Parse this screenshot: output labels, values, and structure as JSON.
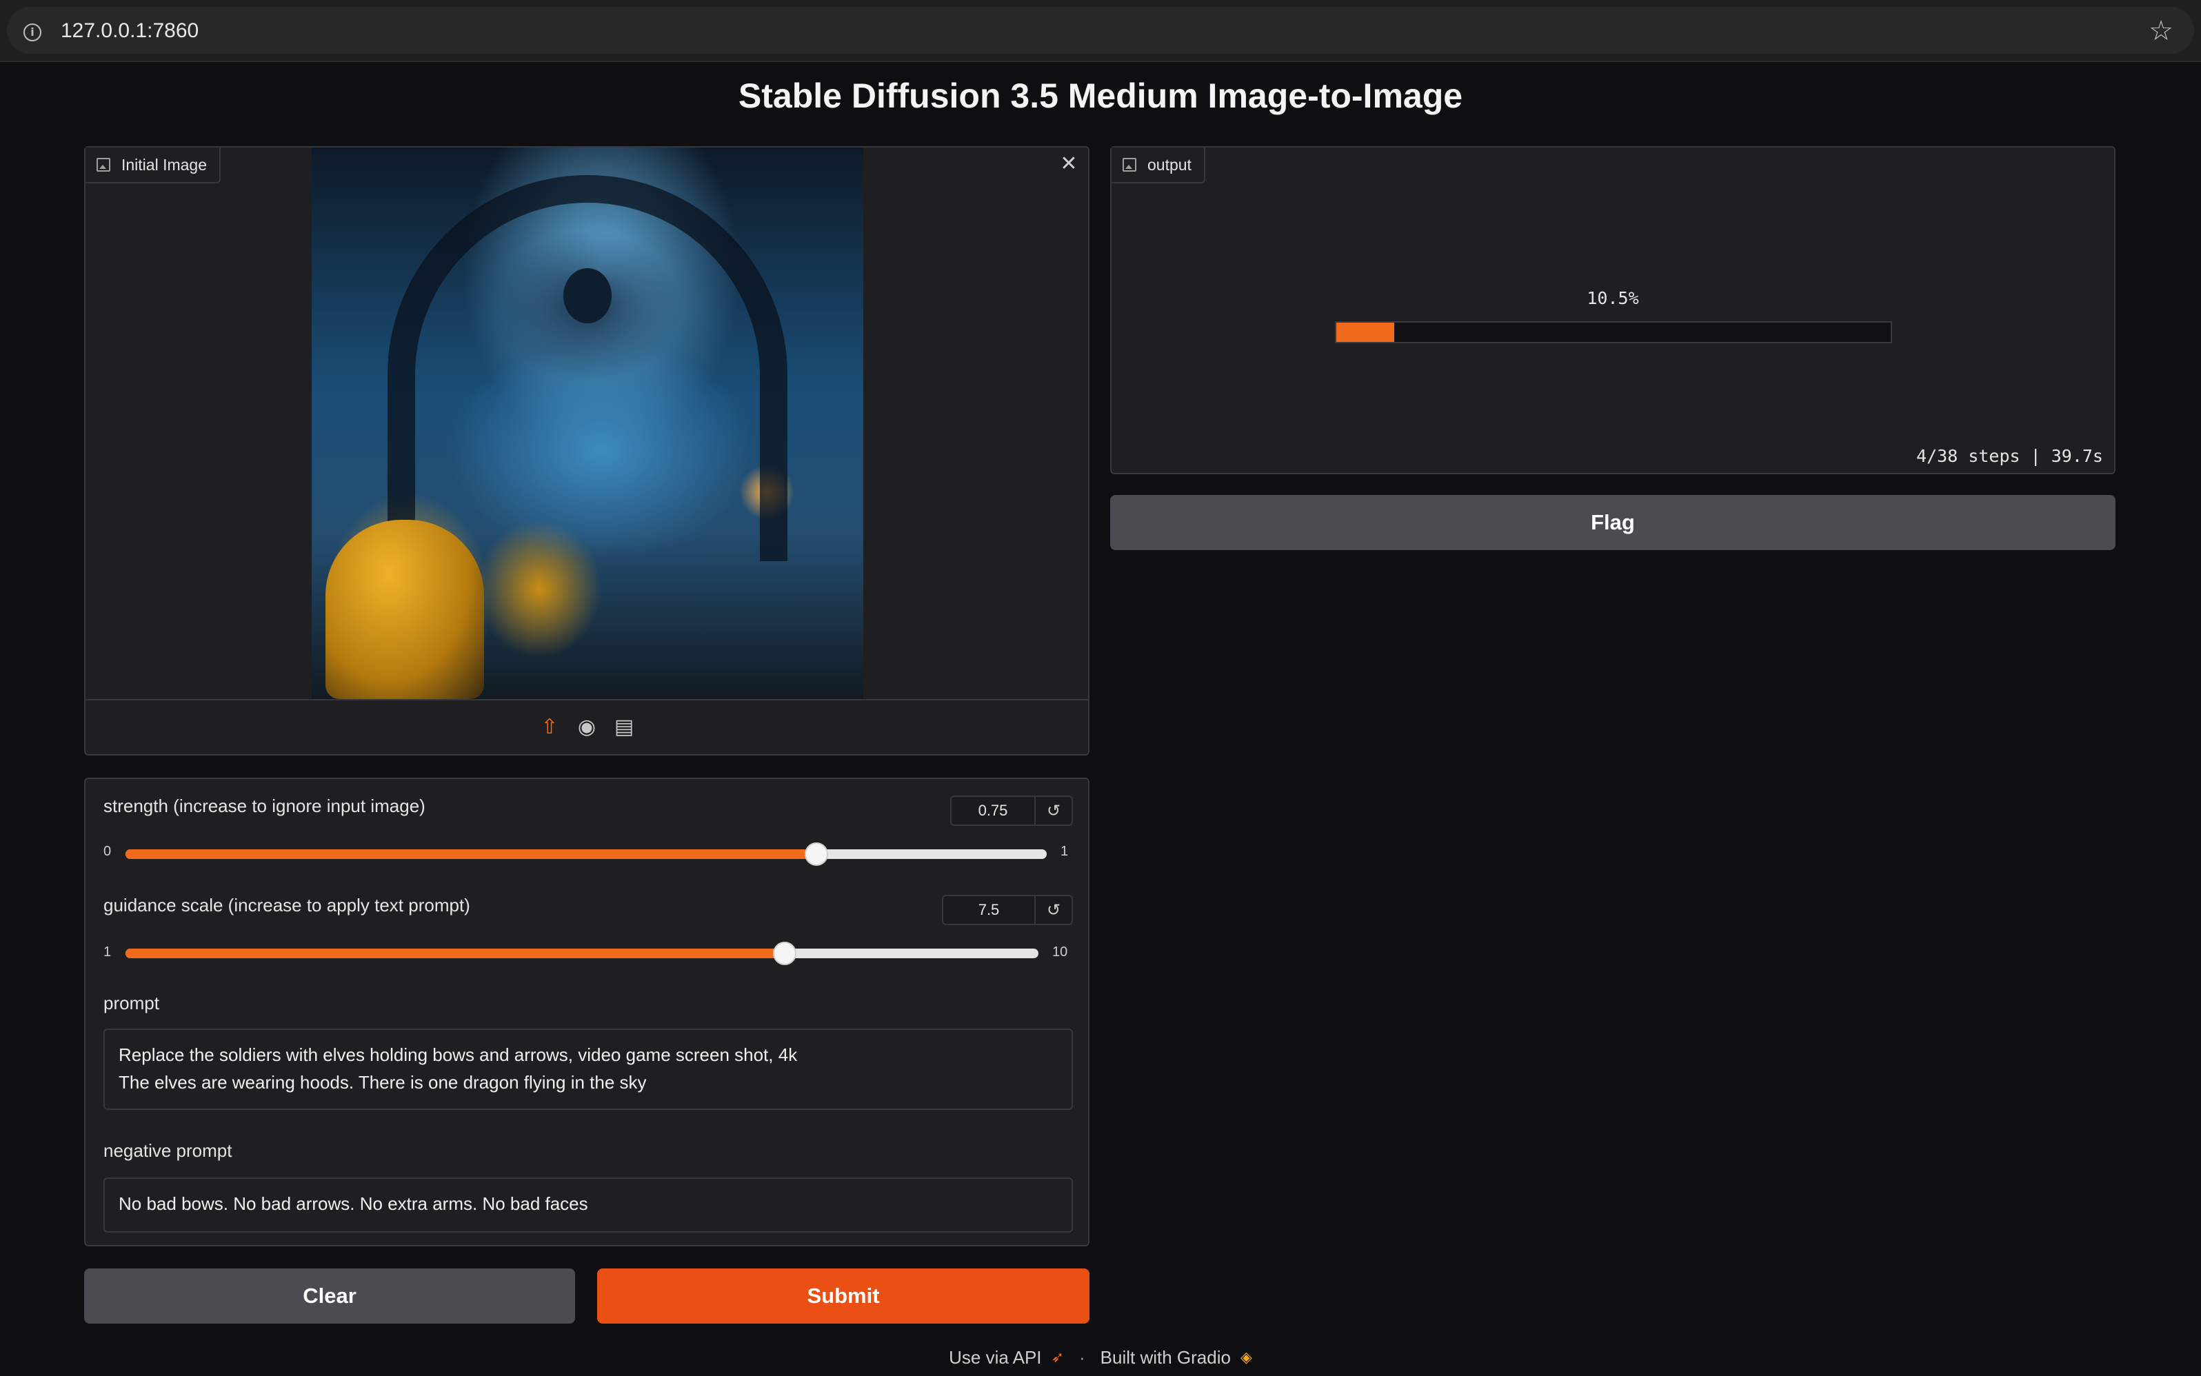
{
  "browser": {
    "url": "127.0.0.1:7860"
  },
  "page": {
    "title": "Stable Diffusion 3.5 Medium Image-to-Image"
  },
  "input_image": {
    "label": "Initial Image",
    "source_icons": [
      "upload-icon",
      "webcam-icon",
      "clipboard-icon"
    ]
  },
  "controls": {
    "strength": {
      "label": "strength (increase to ignore input image)",
      "value": "0.75",
      "min": "0",
      "max": "1",
      "fraction": 0.75
    },
    "guidance": {
      "label": "guidance scale (increase to apply text prompt)",
      "value": "7.5",
      "min": "1",
      "max": "10",
      "fraction": 0.7222
    },
    "prompt": {
      "label": "prompt",
      "value": "Replace the soldiers with elves holding bows and arrows, video game screen shot, 4k\nThe elves are wearing hoods. There is one dragon flying in the sky"
    },
    "negative_prompt": {
      "label": "negative prompt",
      "value": "No bad bows. No bad arrows. No extra arms. No bad faces"
    }
  },
  "buttons": {
    "clear": "Clear",
    "submit": "Submit",
    "flag": "Flag"
  },
  "output": {
    "label": "output",
    "progress_text": "10.5%",
    "progress_fraction": 0.105,
    "eta": "4/38 steps | 39.7s"
  },
  "footer": {
    "api": "Use via API",
    "separator": "·",
    "built_with": "Built with Gradio"
  },
  "colors": {
    "accent": "#ea5014",
    "background": "#0f0f11",
    "panel": "#1f1f22"
  }
}
